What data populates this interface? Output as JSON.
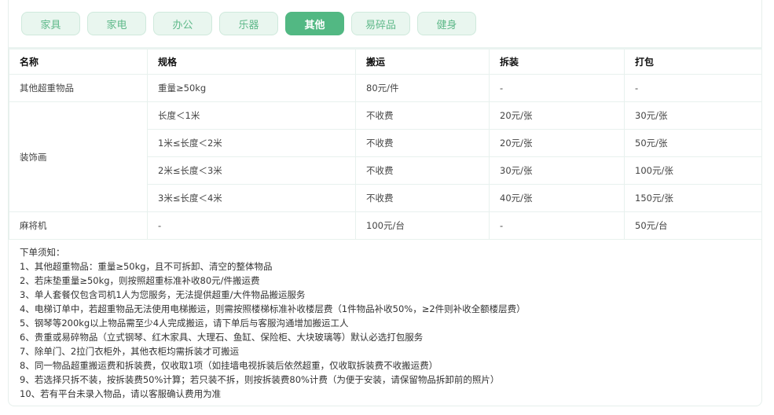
{
  "tabs": [
    {
      "label": "家具"
    },
    {
      "label": "家电"
    },
    {
      "label": "办公"
    },
    {
      "label": "乐器"
    },
    {
      "label": "其他",
      "active": true
    },
    {
      "label": "易碎品"
    },
    {
      "label": "健身"
    }
  ],
  "table": {
    "headers": [
      "名称",
      "规格",
      "搬运",
      "拆装",
      "打包"
    ],
    "rows": [
      {
        "name": "其他超重物品",
        "spec": "重量≥50kg",
        "move": "80元/件",
        "assemble": "-",
        "pack": "-"
      },
      {
        "name": "装饰画",
        "spec": "长度＜1米",
        "move": "不收费",
        "assemble": "20元/张",
        "pack": "30元/张"
      },
      {
        "spec": "1米≤长度＜2米",
        "move": "不收费",
        "assemble": "20元/张",
        "pack": "50元/张"
      },
      {
        "spec": "2米≤长度＜3米",
        "move": "不收费",
        "assemble": "30元/张",
        "pack": "100元/张"
      },
      {
        "spec": "3米≤长度＜4米",
        "move": "不收费",
        "assemble": "40元/张",
        "pack": "150元/张"
      },
      {
        "name": "麻将机",
        "spec": "-",
        "move": "100元/台",
        "assemble": "-",
        "pack": "50元/台"
      }
    ]
  },
  "notes": {
    "title": "下单须知：",
    "items": [
      "1、其他超重物品：重量≥50kg，且不可拆卸、清空的整体物品",
      "2、若床垫重量≥50kg，则按照超重标准补收80元/件搬运费",
      "3、单人套餐仅包含司机1人为您服务，无法提供超重/大件物品搬运服务",
      "4、电梯订单中，若超重物品无法使用电梯搬运，则需按照楼梯标准补收楼层费（1件物品补收50%，≥2件则补收全额楼层费）",
      "5、钢琴等200kg以上物品需至少4人完成搬运，请下单后与客服沟通增加搬运工人",
      "6、贵重或易碎物品（立式钢琴、红木家具、大理石、鱼缸、保险柜、大块玻璃等）默认必选打包服务",
      "7、除单门、2拉门衣柜外，其他衣柜均需拆装才可搬运",
      "8、同一物品超重搬运费和拆装费，仅收取1项（如挂墙电视拆装后依然超重，仅收取拆装费不收搬运费）",
      "9、若选择只拆不装，按拆装费50%计算；若只装不拆，则按拆装费80%计费（为便于安装，请保留物品拆卸前的照片）",
      "10、若有平台未录入物品，请以客服确认费用为准"
    ]
  }
}
